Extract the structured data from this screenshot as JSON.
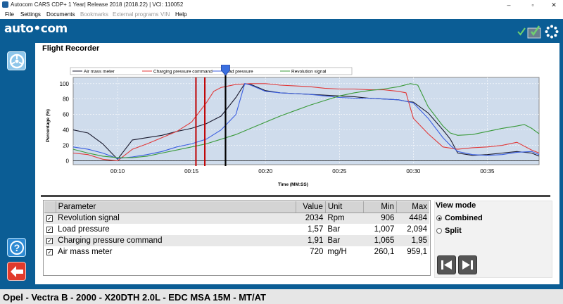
{
  "window": {
    "title": "Autocom CARS CDP+ 1 Year|  Release 2018 (2018.22)  |  VCI: 110052",
    "minimize": "–",
    "maximize": "▫",
    "close": "✕"
  },
  "menu": {
    "file": "File",
    "settings": "Settings",
    "documents": "Documents",
    "bookmarks": "Bookmarks",
    "external": "External programs",
    "vin": "VIN",
    "help": "Help"
  },
  "brand": {
    "logo": "auto•com"
  },
  "tab": {
    "title": "Flight Recorder"
  },
  "colors": {
    "band": "#0b5d95",
    "plot_bg": "#cfdcec",
    "air_mass": "#1a1a2e",
    "charging_pressure": "#e03a3a",
    "load_pressure": "#3b5fe0",
    "revolution": "#3a9a3a",
    "cursor": "#c00000"
  },
  "chart_data": {
    "type": "line",
    "xlabel": "Time (MM:SS)",
    "ylabel": "Percentage (%)",
    "xlim": [
      7,
      38.5
    ],
    "ylim": [
      -5,
      108
    ],
    "x_ticks": [
      10,
      15,
      20,
      25,
      30,
      35
    ],
    "x_tick_labels": [
      "00:10",
      "00:15",
      "00:20",
      "00:25",
      "00:30",
      "00:35"
    ],
    "y_ticks": [
      0,
      20,
      40,
      60,
      80,
      100
    ],
    "legend_position": "top",
    "cursors_x": [
      15.3,
      15.9
    ],
    "marker_x": 17.3,
    "series": [
      {
        "name": "Air mass meter",
        "color_key": "air_mass",
        "x": [
          7,
          8,
          9,
          10,
          11,
          12,
          13,
          14,
          15,
          16,
          17,
          18,
          18.6,
          19,
          20,
          21,
          22,
          23,
          24,
          25,
          26,
          27,
          28,
          29,
          29.5,
          30,
          31,
          32,
          32.5,
          33,
          34,
          35,
          36,
          37,
          38,
          38.5
        ],
        "y": [
          40,
          36,
          22,
          2,
          27,
          30,
          33,
          38,
          42,
          48,
          58,
          82,
          100,
          99,
          91,
          88,
          87,
          86,
          85,
          84,
          83,
          81,
          80,
          79,
          77,
          76,
          62,
          40,
          28,
          10,
          7,
          8,
          10,
          12,
          10,
          6
        ]
      },
      {
        "name": "Charging pressure command",
        "color_key": "charging_pressure",
        "x": [
          7,
          8,
          9,
          10,
          11,
          12,
          13,
          14,
          15,
          16,
          16.5,
          17,
          18,
          19,
          20,
          21,
          22,
          23,
          24,
          25,
          26,
          27,
          28,
          29,
          29.5,
          30,
          31,
          32,
          33,
          34,
          35,
          36,
          37,
          38,
          38.5
        ],
        "y": [
          10,
          8,
          2,
          0,
          15,
          22,
          30,
          38,
          50,
          75,
          90,
          95,
          99,
          100,
          100,
          98,
          97,
          96,
          94,
          93,
          93,
          92,
          92,
          90,
          88,
          55,
          35,
          18,
          15,
          17,
          18,
          20,
          24,
          14,
          10
        ]
      },
      {
        "name": "Load pressure",
        "color_key": "load_pressure",
        "x": [
          7,
          8,
          9,
          10,
          11,
          12,
          13,
          14,
          15,
          16,
          17,
          18,
          18.6,
          19,
          20,
          21,
          22,
          23,
          24,
          25,
          26,
          27,
          28,
          29,
          29.5,
          30,
          31,
          32,
          32.5,
          33,
          34,
          35,
          36,
          37,
          38,
          38.5
        ],
        "y": [
          18,
          15,
          10,
          3,
          5,
          8,
          12,
          18,
          22,
          28,
          40,
          60,
          100,
          98,
          90,
          88,
          87,
          86,
          84,
          82,
          81,
          81,
          80,
          79,
          77,
          75,
          55,
          30,
          20,
          12,
          8,
          7,
          8,
          11,
          12,
          8
        ]
      },
      {
        "name": "Revolution signal",
        "color_key": "revolution",
        "x": [
          7,
          8,
          9,
          10,
          11,
          12,
          13,
          14,
          15,
          16,
          17,
          18,
          19,
          20,
          21,
          22,
          23,
          24,
          25,
          26,
          27,
          28,
          29,
          29.8,
          30.3,
          31,
          32,
          32.5,
          33,
          34,
          35,
          36,
          37,
          37.5,
          38,
          38.5
        ],
        "y": [
          15,
          10,
          6,
          4,
          4,
          6,
          10,
          14,
          18,
          22,
          28,
          34,
          42,
          50,
          58,
          65,
          72,
          78,
          84,
          88,
          91,
          93,
          96,
          100,
          98,
          70,
          45,
          36,
          33,
          34,
          38,
          42,
          45,
          47,
          42,
          35
        ]
      }
    ]
  },
  "table": {
    "headers": {
      "parameter": "Parameter",
      "value": "Value",
      "unit": "Unit",
      "min": "Min",
      "max": "Max"
    },
    "rows": [
      {
        "parameter": "Revolution signal",
        "value": "2034",
        "unit": "Rpm",
        "min": "906",
        "max": "4484"
      },
      {
        "parameter": "Load pressure",
        "value": "1,57",
        "unit": "Bar",
        "min": "1,007",
        "max": "2,094"
      },
      {
        "parameter": "Charging pressure command",
        "value": "1,91",
        "unit": "Bar",
        "min": "1,065",
        "max": "1,95"
      },
      {
        "parameter": "Air mass meter",
        "value": "720",
        "unit": "mg/H",
        "min": "260,1",
        "max": "959,1"
      }
    ],
    "check_mark": "✓"
  },
  "view_mode": {
    "title": "View mode",
    "combined": "Combined",
    "split": "Split"
  },
  "status": {
    "vehicle": "Opel - Vectra B - 2000 - X20DTH 2.0L - EDC MSA 15M - MT/AT"
  }
}
